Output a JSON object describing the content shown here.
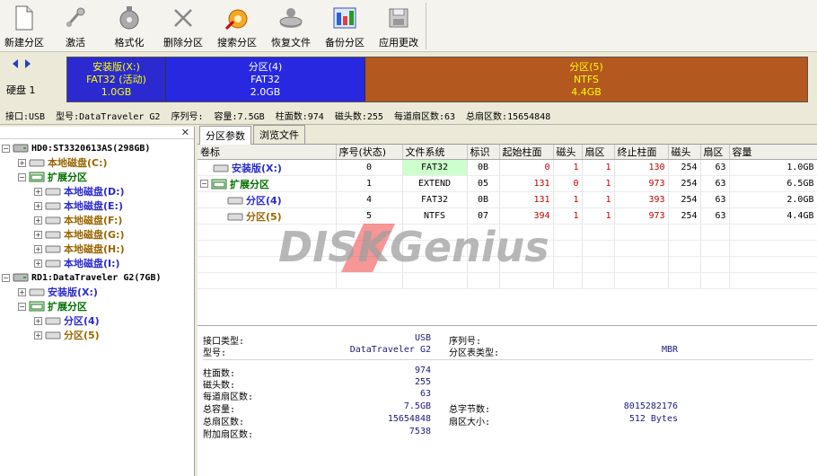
{
  "toolbar": {
    "buttons": [
      {
        "label": "新建分区",
        "icon": "new-partition-icon"
      },
      {
        "label": "激活",
        "icon": "activate-icon"
      },
      {
        "label": "格式化",
        "icon": "format-icon"
      },
      {
        "label": "删除分区",
        "icon": "delete-partition-icon"
      },
      {
        "label": "搜索分区",
        "icon": "search-partition-icon"
      },
      {
        "label": "恢复文件",
        "icon": "recover-file-icon"
      },
      {
        "label": "备份分区",
        "icon": "backup-partition-icon"
      },
      {
        "label": "应用更改",
        "icon": "apply-changes-icon"
      }
    ]
  },
  "diskbar": {
    "disk_label": "硬盘 1",
    "segments": [
      {
        "name": "安装版(X:)",
        "fs": "FAT32 (活动)",
        "size": "1.0GB"
      },
      {
        "name": "分区(4)",
        "fs": "FAT32",
        "size": "2.0GB"
      },
      {
        "name": "分区(5)",
        "fs": "NTFS",
        "size": "4.4GB"
      }
    ]
  },
  "infoline": {
    "interface": "接口:USB",
    "model": "型号:DataTraveler G2",
    "serial": "序列号:",
    "capacity": "容量:7.5GB",
    "cylinders": "柱面数:974",
    "heads": "磁头数:255",
    "sectors_per_track": "每道扇区数:63",
    "total_sectors": "总扇区数:15654848"
  },
  "tree": {
    "hd0": "HD0:ST3320613AS(298GB)",
    "hd0_items": [
      "本地磁盘(C:)",
      "扩展分区",
      "本地磁盘(D:)",
      "本地磁盘(E:)",
      "本地磁盘(F:)",
      "本地磁盘(G:)",
      "本地磁盘(H:)",
      "本地磁盘(I:)"
    ],
    "rd1": "RD1:DataTraveler G2(7GB)",
    "rd1_items": [
      "安装版(X:)",
      "扩展分区",
      "分区(4)",
      "分区(5)"
    ]
  },
  "tabs": [
    "分区参数",
    "浏览文件"
  ],
  "table": {
    "headers": [
      "卷标",
      "序号(状态)",
      "文件系统",
      "标识",
      "起始柱面",
      "磁头",
      "扇区",
      "终止柱面",
      "磁头",
      "扇区",
      "容量"
    ],
    "rows": [
      [
        "安装版(X:)",
        "0",
        "FAT32",
        "0B",
        "0",
        "1",
        "1",
        "130",
        "254",
        "63",
        "1.0GB"
      ],
      [
        "扩展分区",
        "1",
        "EXTEND",
        "05",
        "131",
        "0",
        "1",
        "973",
        "254",
        "63",
        "6.5GB"
      ],
      [
        "分区(4)",
        "4",
        "FAT32",
        "0B",
        "131",
        "1",
        "1",
        "393",
        "254",
        "63",
        "2.0GB"
      ],
      [
        "分区(5)",
        "5",
        "NTFS",
        "07",
        "394",
        "1",
        "1",
        "973",
        "254",
        "63",
        "4.4GB"
      ]
    ]
  },
  "watermark": "DISKGenius",
  "details": {
    "interface_label": "接口类型:",
    "interface_value": "USB",
    "serial_label": "序列号:",
    "serial_value": "",
    "model_label": "型号:",
    "model_value": "DataTraveler G2",
    "pt_type_label": "分区表类型:",
    "pt_type_value": "MBR",
    "cyl_label": "柱面数:",
    "cyl_value": "974",
    "heads_label": "磁头数:",
    "heads_value": "255",
    "spt_label": "每道扇区数:",
    "spt_value": "63",
    "cap_label": "总容量:",
    "cap_value": "7.5GB",
    "total_bytes_label": "总字节数:",
    "total_bytes_value": "8015282176",
    "ts_label": "总扇区数:",
    "ts_value": "15654848",
    "ss_label": "扇区大小:",
    "ss_value": "512 Bytes",
    "extra_label": "附加扇区数:",
    "extra_value": "7538"
  },
  "colors": {
    "install_segment": "#2a2ad0",
    "p4_segment": "#2828e0",
    "p5_segment": "#b3581e",
    "extended_text": "#007000",
    "red_values": "#c00000"
  }
}
